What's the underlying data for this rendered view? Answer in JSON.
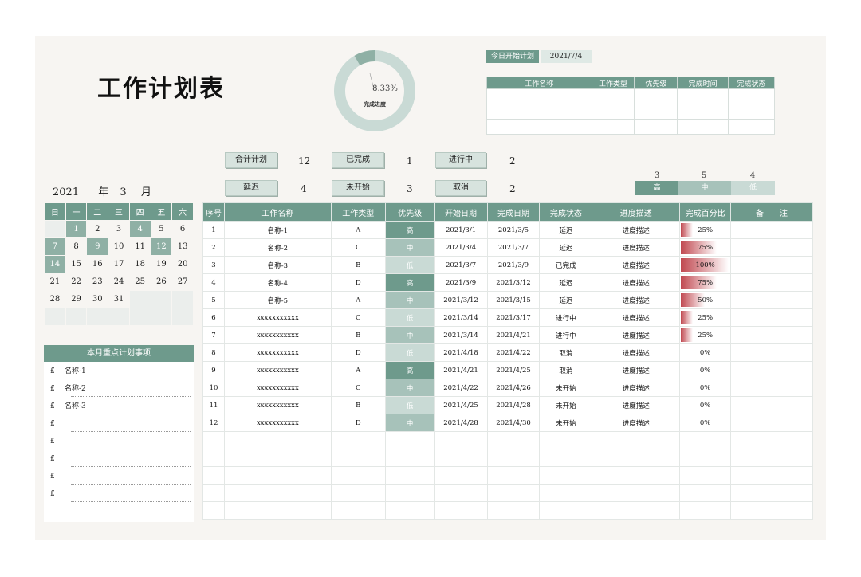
{
  "title": "工作计划表",
  "donut": {
    "percent_label": "8.33%",
    "label": "完成进度",
    "value": 0.0833
  },
  "today": {
    "label": "今日开始计划",
    "date": "2021/7/4",
    "headers": [
      "工作名称",
      "工作类型",
      "优先级",
      "完成时间",
      "完成状态"
    ],
    "rows": 3
  },
  "stats": {
    "total_label": "合计计划",
    "total": "12",
    "done_label": "已完成",
    "done": "1",
    "inprog_label": "进行中",
    "inprog": "2",
    "delay_label": "延迟",
    "delay": "4",
    "notstarted_label": "未开始",
    "notstarted": "3",
    "cancel_label": "取消",
    "cancel": "2"
  },
  "priority_summary": [
    {
      "label": "高",
      "count": "3",
      "color": "#6e9a8c"
    },
    {
      "label": "中",
      "count": "5",
      "color": "#a7c2ba"
    },
    {
      "label": "低",
      "count": "4",
      "color": "#c9dad5"
    }
  ],
  "calendar": {
    "year": "2021",
    "year_unit": "年",
    "month": "3",
    "month_unit": "月",
    "weekdays": [
      "日",
      "一",
      "二",
      "三",
      "四",
      "五",
      "六"
    ],
    "weeks": [
      [
        "",
        "1",
        "2",
        "3",
        "4",
        "5",
        "6"
      ],
      [
        "7",
        "8",
        "9",
        "10",
        "11",
        "12",
        "13"
      ],
      [
        "14",
        "15",
        "16",
        "17",
        "18",
        "19",
        "20"
      ],
      [
        "21",
        "22",
        "23",
        "24",
        "25",
        "26",
        "27"
      ],
      [
        "28",
        "29",
        "30",
        "31",
        "",
        "",
        ""
      ],
      [
        "",
        "",
        "",
        "",
        "",
        "",
        ""
      ]
    ],
    "highlighted": [
      "1",
      "4",
      "7",
      "9",
      "12",
      "14"
    ]
  },
  "focus": {
    "title": "本月重点计划事项",
    "bullet": "£",
    "items": [
      "名称-1",
      "名称-2",
      "名称-3",
      "",
      "",
      "",
      "",
      ""
    ]
  },
  "table": {
    "headers": [
      "序号",
      "工作名称",
      "工作类型",
      "优先级",
      "开始日期",
      "完成日期",
      "完成状态",
      "进度描述",
      "完成百分比",
      "备　　注"
    ],
    "rows": [
      {
        "no": "1",
        "name": "名称-1",
        "type": "A",
        "priority": "高",
        "start": "2021/3/1",
        "end": "2021/3/5",
        "status": "延迟",
        "desc": "进度描述",
        "pct": "25%",
        "pct_value": 0.25,
        "note": ""
      },
      {
        "no": "2",
        "name": "名称-2",
        "type": "C",
        "priority": "中",
        "start": "2021/3/4",
        "end": "2021/3/7",
        "status": "延迟",
        "desc": "进度描述",
        "pct": "75%",
        "pct_value": 0.75,
        "note": ""
      },
      {
        "no": "3",
        "name": "名称-3",
        "type": "B",
        "priority": "低",
        "start": "2021/3/7",
        "end": "2021/3/9",
        "status": "已完成",
        "desc": "进度描述",
        "pct": "100%",
        "pct_value": 1.0,
        "note": ""
      },
      {
        "no": "4",
        "name": "名称-4",
        "type": "D",
        "priority": "高",
        "start": "2021/3/9",
        "end": "2021/3/12",
        "status": "延迟",
        "desc": "进度描述",
        "pct": "75%",
        "pct_value": 0.75,
        "note": ""
      },
      {
        "no": "5",
        "name": "名称-5",
        "type": "A",
        "priority": "中",
        "start": "2021/3/12",
        "end": "2021/3/15",
        "status": "延迟",
        "desc": "进度描述",
        "pct": "50%",
        "pct_value": 0.5,
        "note": ""
      },
      {
        "no": "6",
        "name": "xxxxxxxxxxx",
        "type": "C",
        "priority": "低",
        "start": "2021/3/14",
        "end": "2021/3/17",
        "status": "进行中",
        "desc": "进度描述",
        "pct": "25%",
        "pct_value": 0.25,
        "note": ""
      },
      {
        "no": "7",
        "name": "xxxxxxxxxxx",
        "type": "B",
        "priority": "中",
        "start": "2021/3/14",
        "end": "2021/4/21",
        "status": "进行中",
        "desc": "进度描述",
        "pct": "25%",
        "pct_value": 0.25,
        "note": ""
      },
      {
        "no": "8",
        "name": "xxxxxxxxxxx",
        "type": "D",
        "priority": "低",
        "start": "2021/4/18",
        "end": "2021/4/22",
        "status": "取消",
        "desc": "进度描述",
        "pct": "0%",
        "pct_value": 0,
        "note": ""
      },
      {
        "no": "9",
        "name": "xxxxxxxxxxx",
        "type": "A",
        "priority": "高",
        "start": "2021/4/21",
        "end": "2021/4/25",
        "status": "取消",
        "desc": "进度描述",
        "pct": "0%",
        "pct_value": 0,
        "note": ""
      },
      {
        "no": "10",
        "name": "xxxxxxxxxxx",
        "type": "C",
        "priority": "中",
        "start": "2021/4/22",
        "end": "2021/4/26",
        "status": "未开始",
        "desc": "进度描述",
        "pct": "0%",
        "pct_value": 0,
        "note": ""
      },
      {
        "no": "11",
        "name": "xxxxxxxxxxx",
        "type": "B",
        "priority": "低",
        "start": "2021/4/25",
        "end": "2021/4/28",
        "status": "未开始",
        "desc": "进度描述",
        "pct": "0%",
        "pct_value": 0,
        "note": ""
      },
      {
        "no": "12",
        "name": "xxxxxxxxxxx",
        "type": "D",
        "priority": "中",
        "start": "2021/4/28",
        "end": "2021/4/30",
        "status": "未开始",
        "desc": "进度描述",
        "pct": "0%",
        "pct_value": 0,
        "note": ""
      }
    ],
    "empty_rows": 5
  },
  "colors": {
    "accent": "#6e9a8c",
    "accent_light": "#a7c2ba",
    "accent_pale": "#c9dad5",
    "progress": "#c0474f",
    "background": "#f7f5f2"
  }
}
